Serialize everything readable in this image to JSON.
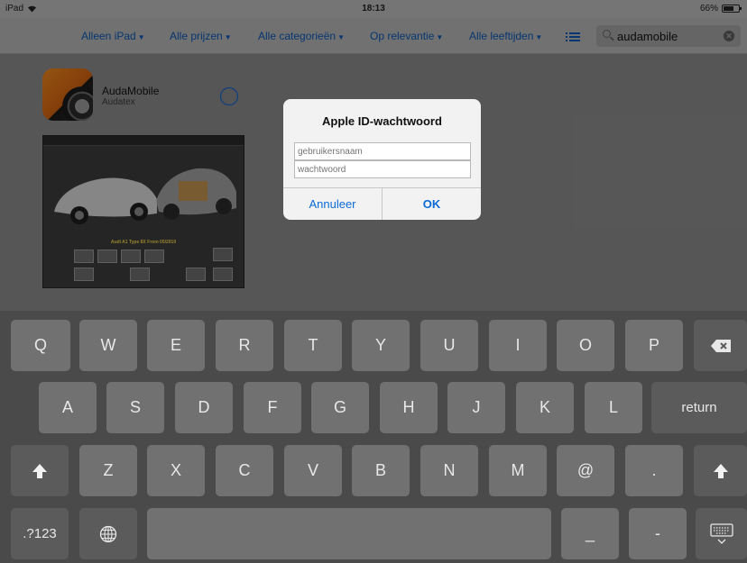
{
  "status_bar": {
    "device": "iPad",
    "time": "18:13",
    "battery": "66%",
    "battery_level": 0.66
  },
  "filters": [
    "Alleen iPad",
    "Alle prijzen",
    "Alle categorieën",
    "Op relevantie",
    "Alle leeftijden"
  ],
  "search": {
    "value": "audamobile"
  },
  "app": {
    "name": "AudaMobile",
    "developer": "Audatex",
    "screenshot_title": "Audi A1 Type 8X From 05/2010"
  },
  "alert": {
    "title": "Apple ID-wachtwoord",
    "username_placeholder": "gebruikersnaam",
    "password_placeholder": "wachtwoord",
    "cancel_label": "Annuleer",
    "ok_label": "OK"
  },
  "keyboard": {
    "row1": [
      "Q",
      "W",
      "E",
      "R",
      "T",
      "Y",
      "U",
      "I",
      "O",
      "P"
    ],
    "row2": [
      "A",
      "S",
      "D",
      "F",
      "G",
      "H",
      "J",
      "K",
      "L"
    ],
    "row3": [
      "Z",
      "X",
      "C",
      "V",
      "B",
      "N",
      "M",
      "@",
      "."
    ],
    "return_label": "return",
    "numbers_label": ".?123",
    "underscore_key": "_",
    "dash_key": "-"
  }
}
